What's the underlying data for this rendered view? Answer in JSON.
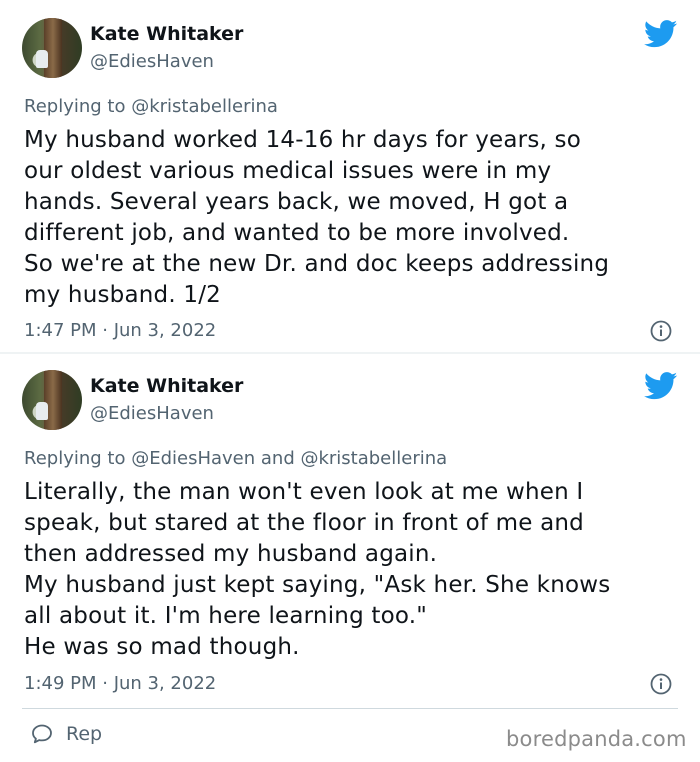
{
  "tweets": [
    {
      "name": "Kate Whitaker",
      "handle": "@EdiesHaven",
      "replying_prefix": "Replying to ",
      "replying_mentions": "@kristabellerina",
      "text": "My husband worked 14-16 hr days for years, so\nour oldest various medical issues were in my\nhands. Several years back, we moved, H got a\ndifferent job, and wanted to be more involved.\nSo we're at the new Dr. and doc keeps addressing\nmy husband.  1/2",
      "timestamp": "1:47 PM · Jun 3, 2022"
    },
    {
      "name": "Kate Whitaker",
      "handle": "@EdiesHaven",
      "replying_prefix": "Replying to ",
      "replying_mentions": "@EdiesHaven and @kristabellerina",
      "text": "Literally, the man won't even look at me when I\nspeak, but stared at the floor in front of me and\nthen addressed my husband again.\nMy husband just kept saying, \"Ask her. She knows\nall about it. I'm here learning too.\"\nHe was so mad though.",
      "timestamp": "1:49 PM · Jun 3, 2022"
    }
  ],
  "footer": {
    "reply_label": "Rep",
    "watermark": "boredpanda.com"
  },
  "colors": {
    "twitter_blue": "#1d9bf0",
    "secondary_text": "#536471"
  },
  "icons": [
    "twitter-bird-icon",
    "info-icon",
    "reply-bubble-icon"
  ]
}
